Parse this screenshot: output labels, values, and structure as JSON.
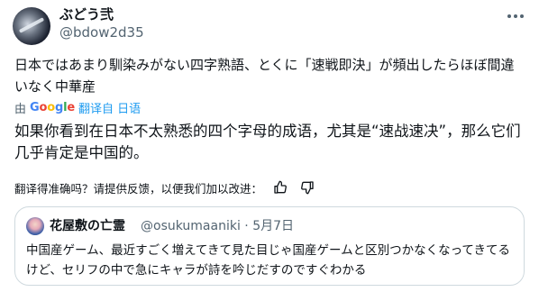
{
  "author": {
    "display_name": "ぶどう弐",
    "handle": "@bdow2d35"
  },
  "post": {
    "original_text": "日本ではあまり馴染みがない四字熟語、とくに「速戦即決」が頻出したらほぼ間違いなく中華産",
    "translated_by": "由",
    "translated_from_link": "翻译自 日语",
    "translated_text": "如果你看到在日本不太熟悉的四个字母的成语，尤其是“速战速决”，那么它们几乎肯定是中国的。",
    "feedback_prompt": "翻译得准确吗？请提供反馈，以便我们加以改进："
  },
  "google_logo": {
    "letters": [
      "G",
      "o",
      "o",
      "g",
      "l",
      "e"
    ]
  },
  "quote": {
    "display_name": "花屋敷の亡霊",
    "handle_and_date": "@osukumaaniki · 5月7日",
    "text": "中国産ゲーム、最近すごく増えてきて見た目じゃ国産ゲームと区別つかなくなってきてるけど、セリフの中で急にキャラが詩を吟じだすのですぐわかる"
  },
  "colors": {
    "text": "#0f1419",
    "secondary": "#536471",
    "link": "#1d9bf0",
    "border": "#cfd9de"
  },
  "icons": [
    "more-icon",
    "thumbs-up-icon",
    "thumbs-down-icon"
  ]
}
